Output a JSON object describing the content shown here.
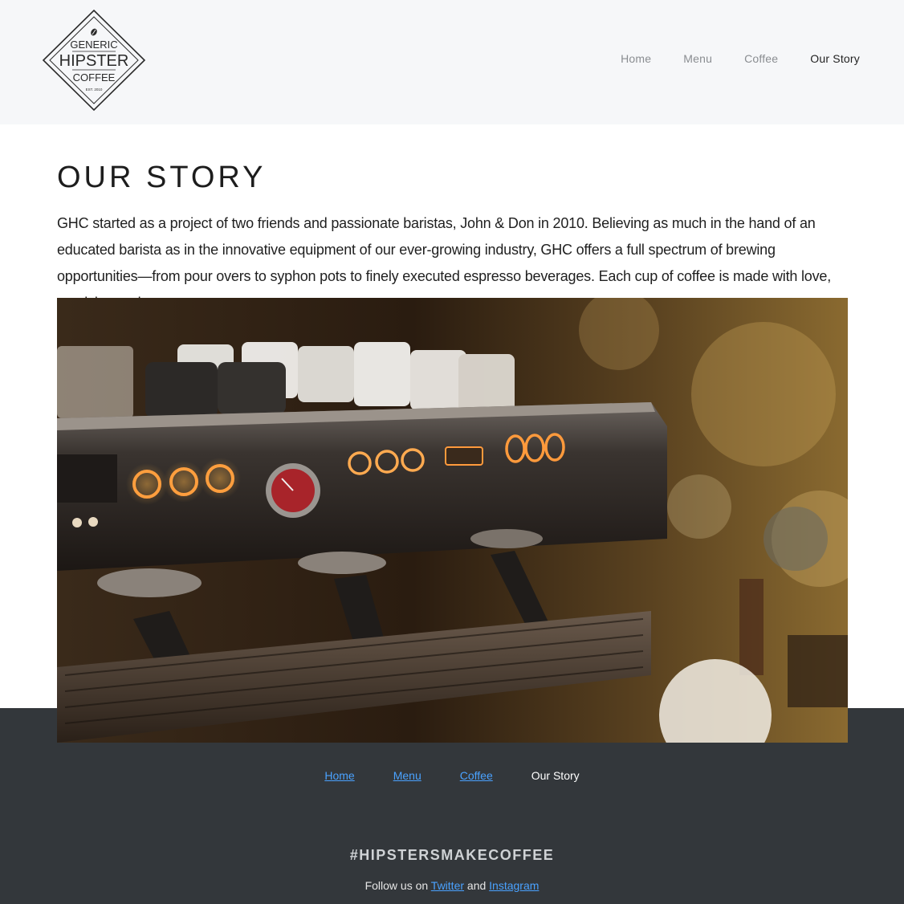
{
  "brand": {
    "line1": "GENERIC",
    "line2": "HIPSTER",
    "line3": "COFFEE",
    "est": "EST. 2010"
  },
  "nav": {
    "items": [
      {
        "label": "Home"
      },
      {
        "label": "Menu"
      },
      {
        "label": "Coffee"
      },
      {
        "label": "Our Story"
      }
    ],
    "active": "Our Story"
  },
  "main": {
    "title": "OUR STORY",
    "intro": "GHC started as a project of two friends and passionate baristas, John & Don in 2010. Believing as much in the hand of an educated barista as in the innovative equipment of our ever-growing industry, GHC offers a full spectrum of brewing opportunities—from pour overs to syphon pots to finely executed espresso beverages. Each cup of coffee is made with love, precision and care."
  },
  "footer": {
    "nav": [
      {
        "label": "Home"
      },
      {
        "label": "Menu"
      },
      {
        "label": "Coffee"
      },
      {
        "label": "Our Story"
      }
    ],
    "hashtag": "#HIPSTERSMAKECOFFEE",
    "follow_prefix": "Follow us on ",
    "twitter_label": "Twitter",
    "follow_and": " and ",
    "instagram_label": "Instagram"
  },
  "colors": {
    "header_bg": "#f6f7f9",
    "footer_bg": "#33373b",
    "link": "#4aa2ff",
    "text": "#1f1f1f"
  }
}
